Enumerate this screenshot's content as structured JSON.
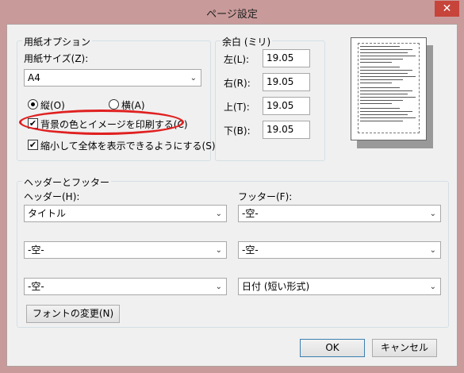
{
  "window": {
    "title": "ページ設定",
    "close_glyph": "✕"
  },
  "paper": {
    "group_label": "用紙オプション",
    "size_label": "用紙サイズ(Z):",
    "size_value": "A4",
    "portrait_label": "縦(O)",
    "landscape_label": "横(A)",
    "orientation_selected": "portrait",
    "print_bg_label": "背景の色とイメージを印刷する(C)",
    "print_bg_checked": true,
    "shrink_label": "縮小して全体を表示できるようにする(S)",
    "shrink_checked": true,
    "highlight_color": "#e02020"
  },
  "margins": {
    "group_label": "余白 (ミリ)",
    "left_label": "左(L):",
    "left_value": "19.05",
    "right_label": "右(R):",
    "right_value": "19.05",
    "top_label": "上(T):",
    "top_value": "19.05",
    "bottom_label": "下(B):",
    "bottom_value": "19.05"
  },
  "header_footer": {
    "group_label": "ヘッダーとフッター",
    "header_label": "ヘッダー(H):",
    "footer_label": "フッター(F):",
    "header_values": [
      "タイトル",
      "-空-",
      "-空-"
    ],
    "footer_values": [
      "-空-",
      "-空-",
      "日付 (短い形式)"
    ],
    "font_button": "フォントの変更(N)"
  },
  "buttons": {
    "ok": "OK",
    "cancel": "キャンセル"
  },
  "icons": {
    "dropdown": "chevron-down-icon",
    "check": "check-icon"
  }
}
